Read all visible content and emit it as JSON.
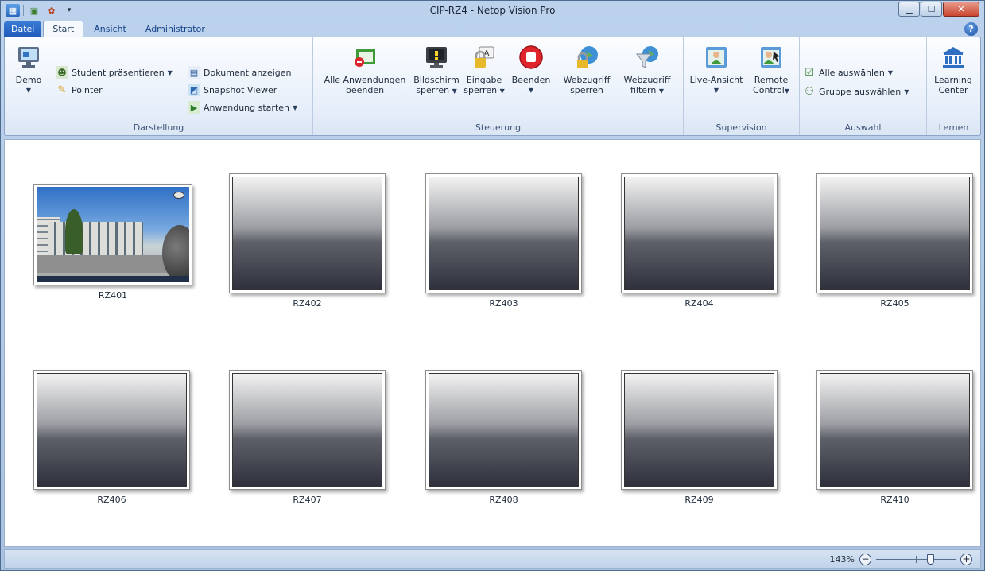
{
  "window": {
    "title": "CIP-RZ4 - Netop Vision Pro"
  },
  "qat": {
    "icons": [
      "app-icon",
      "classroom-icon",
      "network-icon",
      "customize-icon"
    ]
  },
  "tabs": [
    {
      "label": "Datei",
      "type": "file"
    },
    {
      "label": "Start",
      "type": "active"
    },
    {
      "label": "Ansicht",
      "type": "normal"
    },
    {
      "label": "Administrator",
      "type": "normal"
    }
  ],
  "ribbon": {
    "darstellung": {
      "label": "Darstellung",
      "demo": "Demo",
      "student": "Student präsentieren",
      "pointer": "Pointer",
      "dokument": "Dokument anzeigen",
      "snapshot": "Snapshot Viewer",
      "anwendung": "Anwendung starten"
    },
    "steuerung": {
      "label": "Steuerung",
      "alle_l1": "Alle Anwendungen",
      "alle_l2": "beenden",
      "bild_l1": "Bildschirm",
      "bild_l2": "sperren",
      "eingabe_l1": "Eingabe",
      "eingabe_l2": "sperren",
      "beenden": "Beenden",
      "web_sperr_l1": "Webzugriff",
      "web_sperr_l2": "sperren",
      "web_filt_l1": "Webzugriff",
      "web_filt_l2": "filtern"
    },
    "supervision": {
      "label": "Supervision",
      "live": "Live-Ansicht",
      "remote_l1": "Remote",
      "remote_l2": "Control"
    },
    "auswahl": {
      "label": "Auswahl",
      "alle": "Alle auswählen",
      "gruppe": "Gruppe auswählen"
    },
    "lernen": {
      "label": "Lernen",
      "center_l1": "Learning",
      "center_l2": "Center"
    }
  },
  "computers": [
    "RZ401",
    "RZ402",
    "RZ403",
    "RZ404",
    "RZ405",
    "RZ406",
    "RZ407",
    "RZ408",
    "RZ409",
    "RZ410"
  ],
  "status": {
    "zoom": "143%",
    "zoom_level": 0.7
  },
  "colors": {
    "accent": "#1e5bb8",
    "ribbon_bg": "#e8effa",
    "stop_red": "#e0242b"
  }
}
